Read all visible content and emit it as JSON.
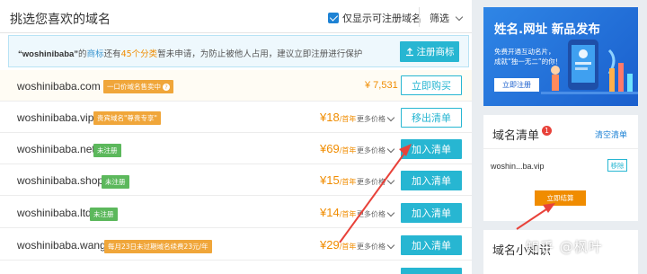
{
  "header": {
    "title": "挑选您喜欢的域名",
    "filter_label": "仅显示可注册域名",
    "sort_label": "筛选"
  },
  "notice": {
    "name": "“woshinibaba”",
    "t1": "的",
    "t2": "商标",
    "t3": "还有",
    "t4": "45个分类",
    "t5": "暂未申请，为防止被他人占用，建议立即注册进行保护",
    "button": "注册商标"
  },
  "rows": [
    {
      "domain": "woshinibaba.com",
      "tag": "一口价域名售卖中",
      "price": "¥ 7,531",
      "unit": "",
      "more": "",
      "button": "立即购买"
    },
    {
      "domain": "woshinibaba.vip",
      "tag": "贵宾域名\"尊贵专享\"",
      "price": "¥18",
      "unit": "/首年",
      "more": "更多价格",
      "button": "移出清单"
    },
    {
      "domain": "woshinibaba.net",
      "tag": "未注册",
      "price": "¥69",
      "unit": "/首年",
      "more": "更多价格",
      "button": "加入清单"
    },
    {
      "domain": "woshinibaba.shop",
      "tag": "未注册",
      "price": "¥15",
      "unit": "/首年",
      "more": "更多价格",
      "button": "加入清单"
    },
    {
      "domain": "woshinibaba.ltd",
      "tag": "未注册",
      "price": "¥14",
      "unit": "/首年",
      "more": "更多价格",
      "button": "加入清单"
    },
    {
      "domain": "woshinibaba.wang",
      "tag": "每月23日未过期域名续费23元/年",
      "price": "¥29",
      "unit": "/首年",
      "more": "更多价格",
      "button": "加入清单"
    }
  ],
  "banner": {
    "title": "姓名.网址 新品发布",
    "line1": "免费开通互动名片，",
    "line2": "成就“独一无二”的你！",
    "button": "立即注册"
  },
  "cart": {
    "title": "域名清单",
    "count": "1",
    "clear": "清空清单",
    "item": "woshin...ba.vip",
    "remove": "移除",
    "checkout": "立即结算"
  },
  "knowledge": {
    "title": "域名小知识"
  },
  "watermark": "知乎 @枫叶",
  "colors": {
    "accent": "#27b6d2",
    "price": "#f08c00",
    "tag_green": "#5cb85c",
    "tag_orange": "#f0a63a",
    "banner": "#1a5fcd",
    "arrow": "#e8423a"
  }
}
